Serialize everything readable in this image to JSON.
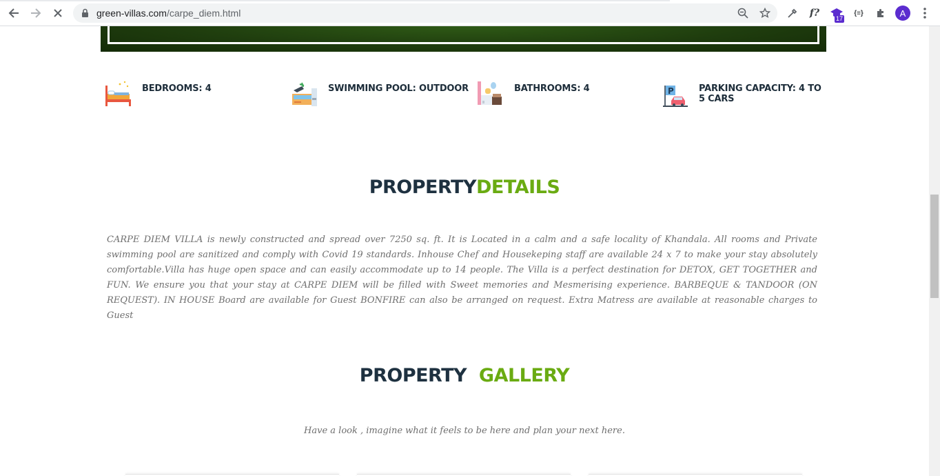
{
  "browser": {
    "url_host": "green-villas.com",
    "url_path": "/carpe_diem.html",
    "extension_badge": "17",
    "avatar_letter": "A",
    "formula_ext_label": "f?",
    "json_ext_label": "{≡}"
  },
  "amenities": [
    {
      "icon": "bed-icon",
      "label": "BEDROOMS: 4"
    },
    {
      "icon": "swimming-pool-icon",
      "label": "SWIMMING POOL: OUTDOOR"
    },
    {
      "icon": "bathroom-icon",
      "label": "BATHROOMS: 4"
    },
    {
      "icon": "parking-icon",
      "label": "PARKING CAPACITY: 4 TO 5 CARS"
    }
  ],
  "details": {
    "title_part1": "PROPERTY",
    "title_part2": "DETAILS",
    "text": "CARPE DIEM VILLA is newly constructed and spread over 7250 sq. ft. It is Located in a calm and a safe locality of Khandala. All rooms and Private swimming pool are sanitized and comply with Covid 19 standards. Inhouse Chef and Housekeping staff are available 24 x 7 to make your stay absolutely comfortable.Villa has huge open space and can easily accommodate up to 14 people. The Villa is a perfect destination for DETOX, GET TOGETHER and FUN. We ensure you that your stay at CARPE DIEM will be filled with Sweet memories and Mesmerising experience. BARBEQUE & TANDOOR (ON REQUEST). IN HOUSE Board are available for Guest BONFIRE can also be arranged on request. Extra Matress are available at reasonable charges to Guest"
  },
  "gallery": {
    "title_part1": "PROPERTY",
    "title_part2": "GALLERY",
    "tagline": "Have a look , imagine what it feels to be here and plan your next here."
  },
  "colors": {
    "title_dark": "#1e3140",
    "title_green": "#6aab12",
    "body_text": "#6e6e6e"
  }
}
